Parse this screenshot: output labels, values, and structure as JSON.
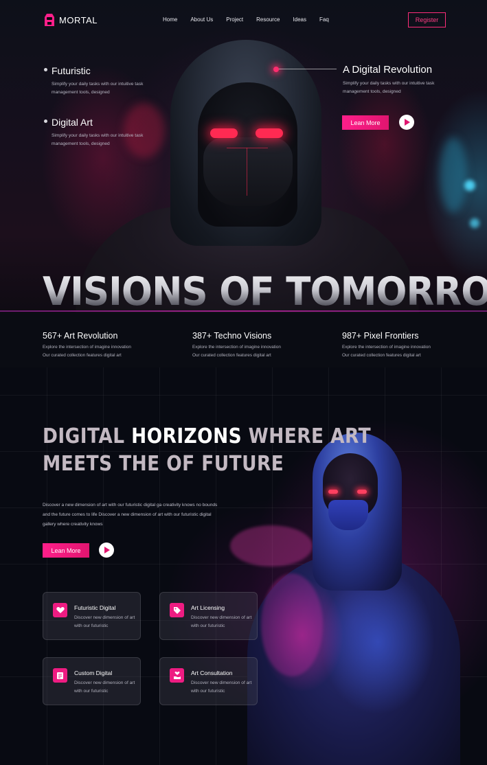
{
  "brand": {
    "name": "MORTAL",
    "accent": "#ff1f8a"
  },
  "nav": {
    "items": [
      "Home",
      "About Us",
      "Project",
      "Resource",
      "Ideas",
      "Faq"
    ],
    "register_label": "Register"
  },
  "hero": {
    "features_left": [
      {
        "title": "Futuristic",
        "text": "Simplify your daily tasks with our intuitive task management tools, designed"
      },
      {
        "title": "Digital Art",
        "text": "Simplify your daily tasks with our intuitive task management tools, designed"
      }
    ],
    "feature_right": {
      "title": "A Digital Revolution",
      "text": "Simplify your daily tasks with our intuitive task management tools, designed"
    },
    "cta_label": "Lean More",
    "headline": "VISIONS OF TOMORROW"
  },
  "stats": [
    {
      "title": "567+ Art Revolution",
      "line1": "Explore the intersection of imagine innovation",
      "line2": "Our curated collection features digital art"
    },
    {
      "title": "387+ Techno Visions",
      "line1": "Explore the intersection of imagine innovation",
      "line2": "Our curated collection features digital art"
    },
    {
      "title": "987+ Pixel Frontiers",
      "line1": "Explore the intersection of imagine innovation",
      "line2": "Our curated collection features digital art"
    }
  ],
  "section": {
    "title_a": "DIGITAL ",
    "title_hl": "HORIZONS",
    "title_b": " WHERE ART",
    "title_line2": "MEETS THE OF FUTURE",
    "description": "Discover a new dimension of art with our futuristic digital ga creativity knows no bounds and the future comes to life Discover a new dimension of art with our futuristic digital gallery where creativity knows",
    "cta_label": "Lean More"
  },
  "cards": [
    {
      "title": "Futuristic Digital",
      "text": "Discover new dimension of art with our futuristic",
      "icon": "heart-hand-icon"
    },
    {
      "title": "Art Licensing",
      "text": "Discover new dimension of art with our futuristic",
      "icon": "tag-icon"
    },
    {
      "title": "Custom Digital",
      "text": "Discover new dimension of art with our futuristic",
      "icon": "document-icon"
    },
    {
      "title": "Art Consultation",
      "text": "Discover new dimension of art with our futuristic",
      "icon": "consult-icon"
    }
  ]
}
